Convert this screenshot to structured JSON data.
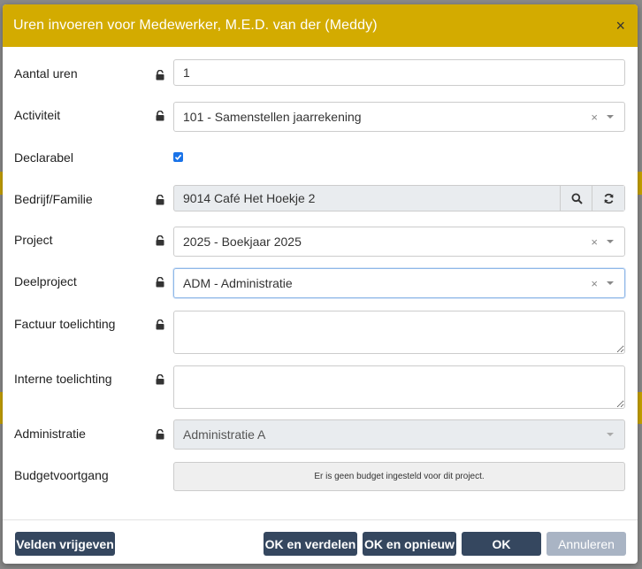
{
  "dialog": {
    "title": "Uren invoeren voor Medewerker, M.E.D. van der (Meddy)",
    "close_label": "×"
  },
  "fields": {
    "aantal_uren": {
      "label": "Aantal uren",
      "value": "1"
    },
    "activiteit": {
      "label": "Activiteit",
      "value": "101 - Samenstellen jaarrekening"
    },
    "declarabel": {
      "label": "Declarabel",
      "checked": true
    },
    "bedrijf": {
      "label": "Bedrijf/Familie",
      "value": "9014 Café Het Hoekje 2"
    },
    "project": {
      "label": "Project",
      "value": "2025 - Boekjaar 2025"
    },
    "deelproject": {
      "label": "Deelproject",
      "value": "ADM - Administratie"
    },
    "factuur_toelichting": {
      "label": "Factuur toelichting",
      "value": ""
    },
    "interne_toelichting": {
      "label": "Interne toelichting",
      "value": ""
    },
    "administratie": {
      "label": "Administratie",
      "value": "Administratie A"
    },
    "budgetvoortgang": {
      "label": "Budgetvoortgang",
      "message": "Er is geen budget ingesteld voor dit project."
    }
  },
  "select_clear": "×",
  "footer": {
    "release_fields": "Velden vrijgeven",
    "ok_distribute": "OK en verdelen",
    "ok_again": "OK en opnieuw",
    "ok": "OK",
    "cancel": "Annuleren"
  },
  "colors": {
    "header": "#d3ab00",
    "button": "#35475f",
    "button_disabled": "#a9b4c4"
  },
  "icons": [
    "lock-icon",
    "search-icon",
    "refresh-icon",
    "close-icon",
    "chevron-down-icon",
    "check-icon"
  ]
}
